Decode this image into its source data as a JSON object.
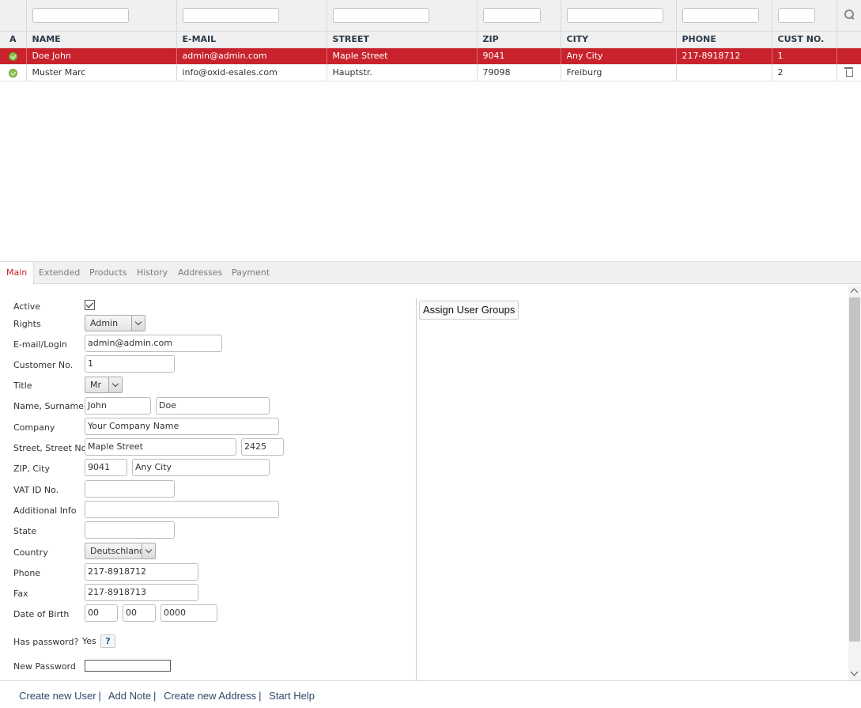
{
  "list": {
    "headers": [
      "A",
      "NAME",
      "E-MAIL",
      "STREET",
      "ZIP",
      "CITY",
      "PHONE",
      "CUST NO."
    ],
    "rows": [
      {
        "name": "Doe John",
        "email": "admin@admin.com",
        "street": "Maple Street",
        "zip": "9041",
        "city": "Any City",
        "phone": "217-8918712",
        "custno": "1",
        "selected": true
      },
      {
        "name": "Muster Marc",
        "email": "info@oxid-esales.com",
        "street": "Hauptstr.",
        "zip": "79098",
        "city": "Freiburg",
        "phone": "",
        "custno": "2",
        "selected": false
      }
    ]
  },
  "tabs": [
    "Main",
    "Extended",
    "Products",
    "History",
    "Addresses",
    "Payment"
  ],
  "form": {
    "labels": {
      "active": "Active",
      "rights": "Rights",
      "email": "E-mail/Login",
      "custno": "Customer No.",
      "title": "Title",
      "name": "Name, Surname",
      "company": "Company",
      "street": "Street, Street No.",
      "zipcity": "ZIP, City",
      "vat": "VAT ID No.",
      "addinfo": "Additional Info",
      "state": "State",
      "country": "Country",
      "phone": "Phone",
      "fax": "Fax",
      "dob": "Date of Birth",
      "haspassword": "Has password?",
      "newpassword": "New Password"
    },
    "values": {
      "rights": "Admin",
      "email": "admin@admin.com",
      "custno": "1",
      "title": "Mr",
      "firstname": "John",
      "lastname": "Doe",
      "company": "Your Company Name",
      "street": "Maple Street",
      "streetno": "2425",
      "zip": "9041",
      "city": "Any City",
      "vat": "",
      "addinfo": "",
      "state": "",
      "country": "Deutschland",
      "phone": "217-8918712",
      "fax": "217-8918713",
      "dob_day": "00",
      "dob_month": "00",
      "dob_year": "0000",
      "haspassword": "Yes",
      "help": "?"
    }
  },
  "right": {
    "assign_groups": "Assign User Groups"
  },
  "footer": {
    "links": [
      "Create new User",
      "Add Note",
      "Create new Address",
      "Start Help"
    ],
    "separator": "|"
  },
  "colors": {
    "accent": "#c8232c",
    "link": "#2d4a6b"
  }
}
